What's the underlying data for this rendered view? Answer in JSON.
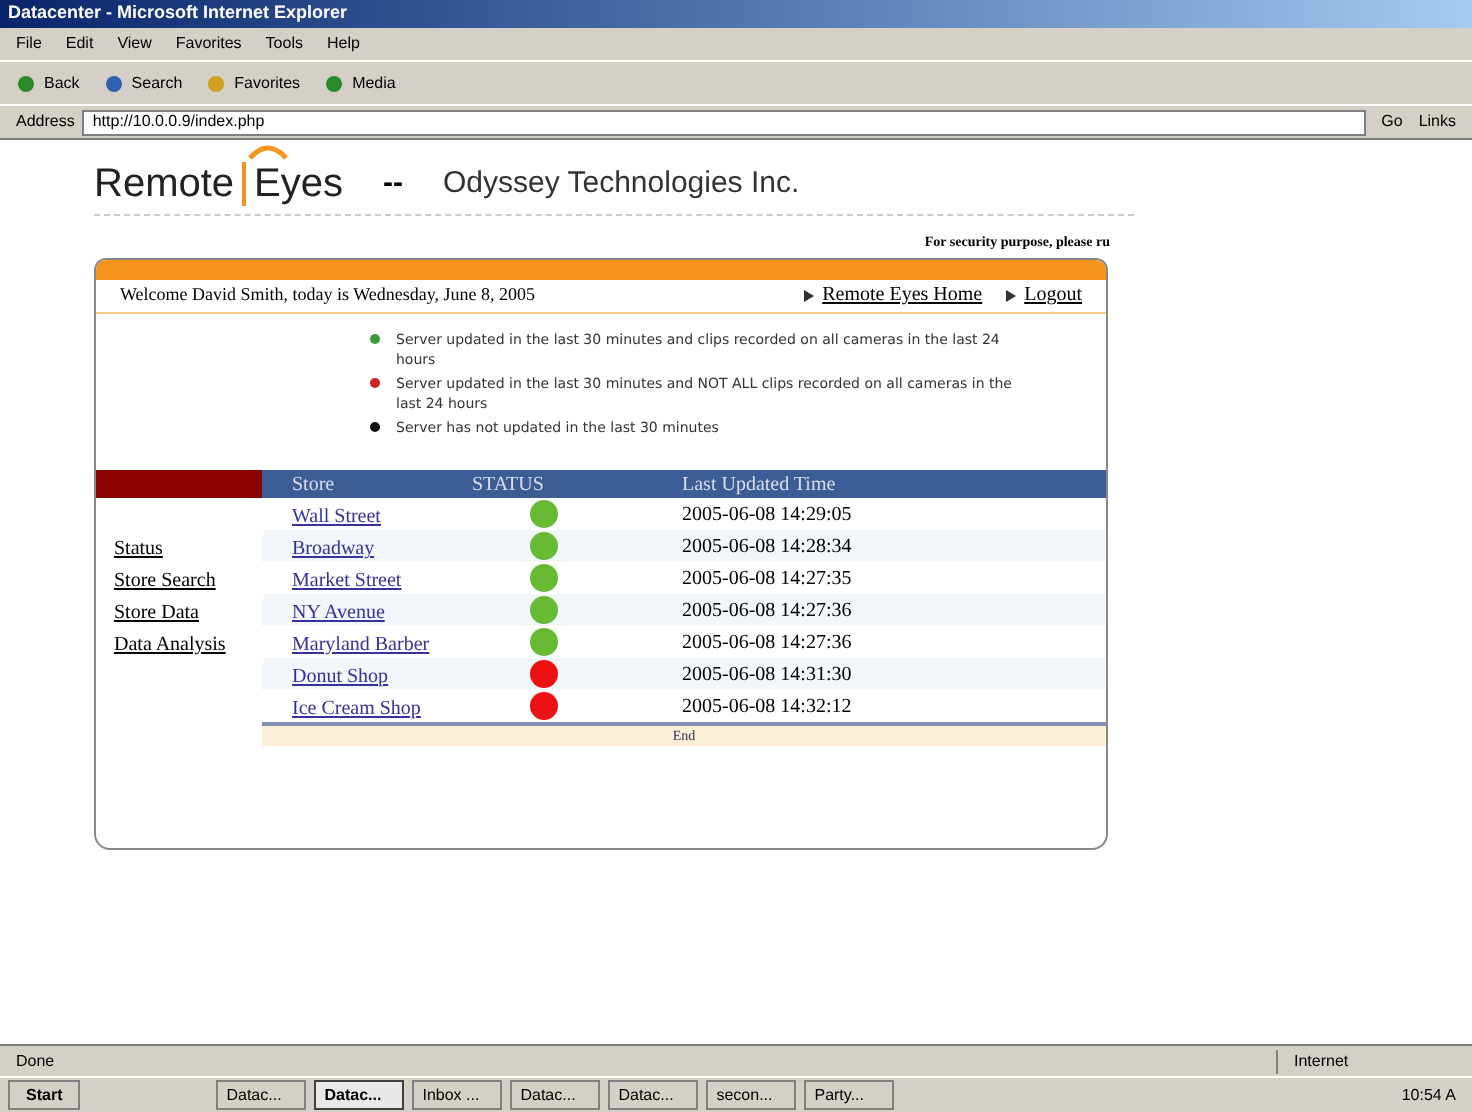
{
  "window": {
    "title": "Datacenter - Microsoft Internet Explorer"
  },
  "menu": [
    "File",
    "Edit",
    "View",
    "Favorites",
    "Tools",
    "Help"
  ],
  "toolbar": [
    {
      "kind": "back",
      "label": "Back"
    },
    {
      "kind": "search",
      "label": "Search"
    },
    {
      "kind": "favorites",
      "label": "Favorites"
    },
    {
      "kind": "media",
      "label": "Media"
    }
  ],
  "address": {
    "label": "Address",
    "value": "http://10.0.0.9/index.php",
    "go": "Go",
    "links": "Links"
  },
  "page": {
    "logo": {
      "word_1": "Remote",
      "word_2": "Eyes"
    },
    "separator": "--",
    "company": "Odyssey Technologies Inc.",
    "security_note": "For security purpose, please ru",
    "welcome": "Welcome David Smith, today is Wednesday, June 8, 2005",
    "top_links": [
      "Remote Eyes Home",
      "Logout"
    ],
    "legend": [
      {
        "color": "#3a9a3a",
        "text": "Server updated in the last 30 minutes and clips recorded on all cameras in the last 24 hours"
      },
      {
        "color": "#cc2222",
        "text": "Server updated in the last 30 minutes and NOT ALL clips recorded on all cameras in the last 24 hours"
      },
      {
        "color": "#111111",
        "text": "Server has not updated in the last 30 minutes"
      }
    ],
    "nav": [
      "Status",
      "Store Search",
      "Store Data",
      "Data Analysis"
    ],
    "table": {
      "columns": [
        "Store",
        "STATUS",
        "Last Updated Time"
      ],
      "rows": [
        {
          "store": "Wall Street",
          "color": "#66bb33",
          "time": "2005-06-08 14:29:05"
        },
        {
          "store": "Broadway",
          "color": "#66bb33",
          "time": "2005-06-08 14:28:34"
        },
        {
          "store": "Market Street",
          "color": "#66bb33",
          "time": "2005-06-08 14:27:35"
        },
        {
          "store": "NY Avenue",
          "color": "#66bb33",
          "time": "2005-06-08 14:27:36"
        },
        {
          "store": "Maryland Barber",
          "color": "#66bb33",
          "time": "2005-06-08 14:27:36"
        },
        {
          "store": "Donut Shop",
          "color": "#ee1111",
          "time": "2005-06-08 14:31:30"
        },
        {
          "store": "Ice Cream Shop",
          "color": "#ee1111",
          "time": "2005-06-08 14:32:12"
        }
      ],
      "footer": "End"
    }
  },
  "status_bar": {
    "text": "Done",
    "zone": "Internet"
  },
  "taskbar": {
    "start": "Start",
    "tasks": [
      {
        "label": "Datac...",
        "selected": false
      },
      {
        "label": "Datac...",
        "selected": true
      },
      {
        "label": "Inbox ...",
        "selected": false
      },
      {
        "label": "Datac...",
        "selected": false
      },
      {
        "label": "Datac...",
        "selected": false
      },
      {
        "label": "secon...",
        "selected": false
      },
      {
        "label": "Party...",
        "selected": false
      }
    ],
    "clock": "10:54 A"
  }
}
